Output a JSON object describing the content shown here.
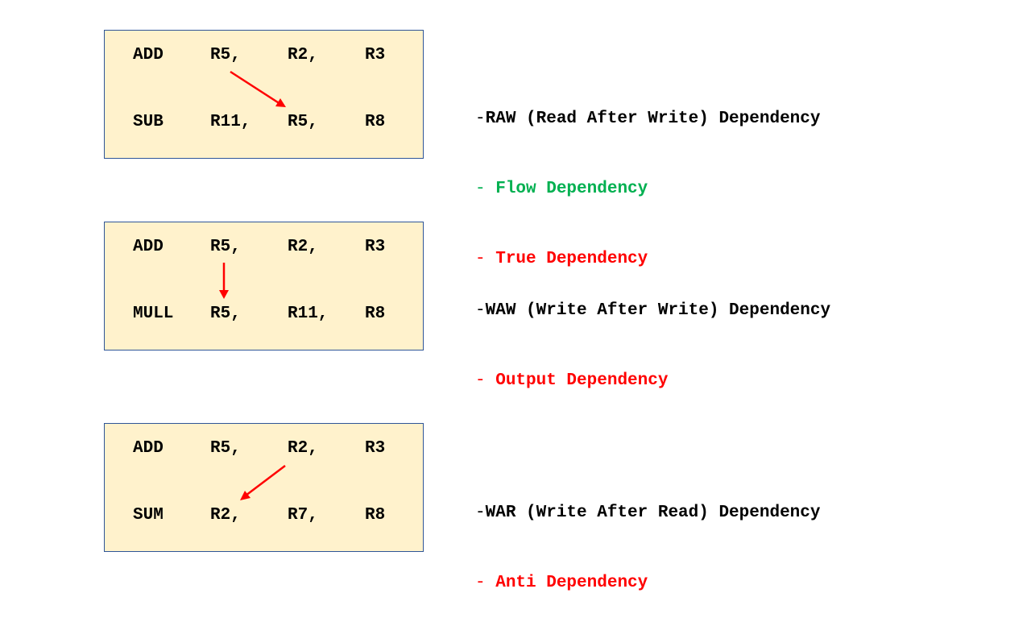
{
  "colors": {
    "box_fill": "#fff2cc",
    "box_border": "#2f5597",
    "arrow": "#ff0000",
    "flow": "#00b050",
    "true_output_anti": "#ff0000"
  },
  "examples": [
    {
      "row1": [
        "ADD",
        "R5,",
        "R2,",
        "R3"
      ],
      "row2": [
        "SUB",
        "R11,",
        "R5,",
        "R8"
      ],
      "heading": "RAW (Read After Write) Dependency",
      "notes": [
        "Flow Dependency",
        "True Dependency"
      ]
    },
    {
      "row1": [
        "ADD",
        "R5,",
        "R2,",
        "R3"
      ],
      "row2": [
        "MULL",
        "R5,",
        "R11,",
        "R8"
      ],
      "heading": "WAW (Write After Write) Dependency",
      "notes": [
        "Output Dependency"
      ]
    },
    {
      "row1": [
        "ADD",
        "R5,",
        "R2,",
        "R3"
      ],
      "row2": [
        "SUM",
        "R2,",
        "R7,",
        "R8"
      ],
      "heading": "WAR (Write After Read) Dependency",
      "notes": [
        "Anti Dependency"
      ]
    }
  ],
  "dash": "-"
}
